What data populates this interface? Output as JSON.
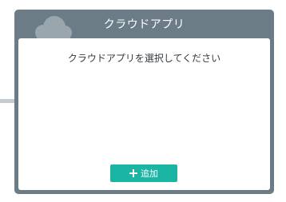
{
  "card": {
    "title": "クラウドアプリ",
    "prompt": "クラウドアプリを選択してください",
    "add_button_label": "追加",
    "header_icon": "cloud-icon"
  },
  "colors": {
    "card_frame": "#6c7c86",
    "button": "#1bb5a4",
    "cloud": "#9aa6ad"
  }
}
